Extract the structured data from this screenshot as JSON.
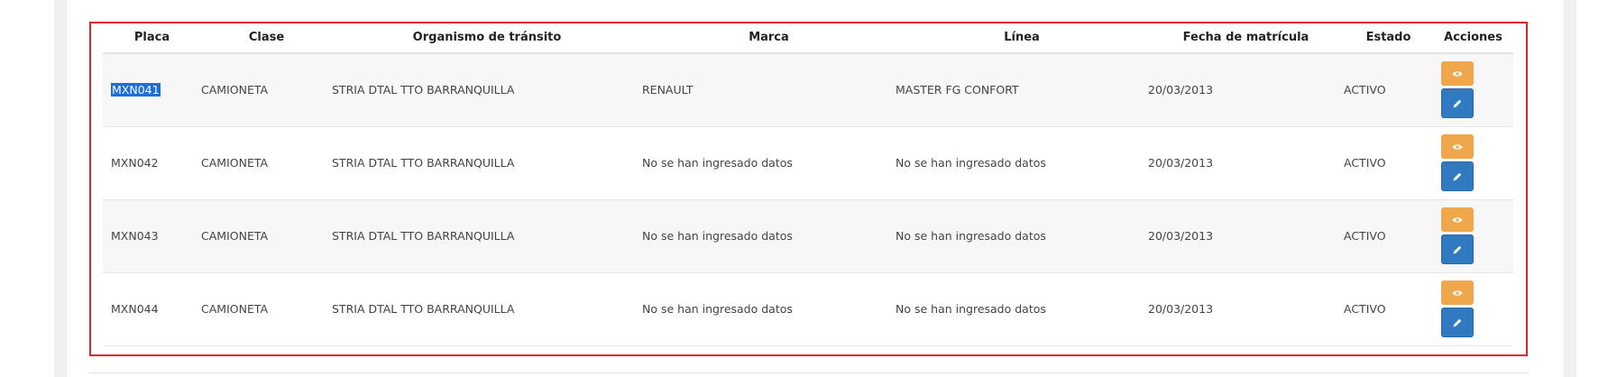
{
  "table": {
    "headers": [
      "Placa",
      "Clase",
      "Organismo de tránsito",
      "Marca",
      "Línea",
      "Fecha de matrícula",
      "Estado",
      "Acciones"
    ],
    "rows": [
      {
        "placa": "MXN041",
        "clase": "CAMIONETA",
        "organismo": "STRIA DTAL TTO BARRANQUILLA",
        "marca": "RENAULT",
        "linea": "MASTER FG CONFORT",
        "fecha": "20/03/2013",
        "estado": "ACTIVO"
      },
      {
        "placa": "MXN042",
        "clase": "CAMIONETA",
        "organismo": "STRIA DTAL TTO BARRANQUILLA",
        "marca": "No se han ingresado datos",
        "linea": "No se han ingresado datos",
        "fecha": "20/03/2013",
        "estado": "ACTIVO"
      },
      {
        "placa": "MXN043",
        "clase": "CAMIONETA",
        "organismo": "STRIA DTAL TTO BARRANQUILLA",
        "marca": "No se han ingresado datos",
        "linea": "No se han ingresado datos",
        "fecha": "20/03/2013",
        "estado": "ACTIVO"
      },
      {
        "placa": "MXN044",
        "clase": "CAMIONETA",
        "organismo": "STRIA DTAL TTO BARRANQUILLA",
        "marca": "No se han ingresado datos",
        "linea": "No se han ingresado datos",
        "fecha": "20/03/2013",
        "estado": "ACTIVO"
      }
    ],
    "selected_row": 0,
    "action_icons": [
      "eye-icon",
      "pencil-icon"
    ]
  },
  "colors": {
    "highlight_border": "#e0262b",
    "view_button": "#f0a64a",
    "edit_button": "#2f7ac1",
    "selection": "#1e6fd9"
  }
}
